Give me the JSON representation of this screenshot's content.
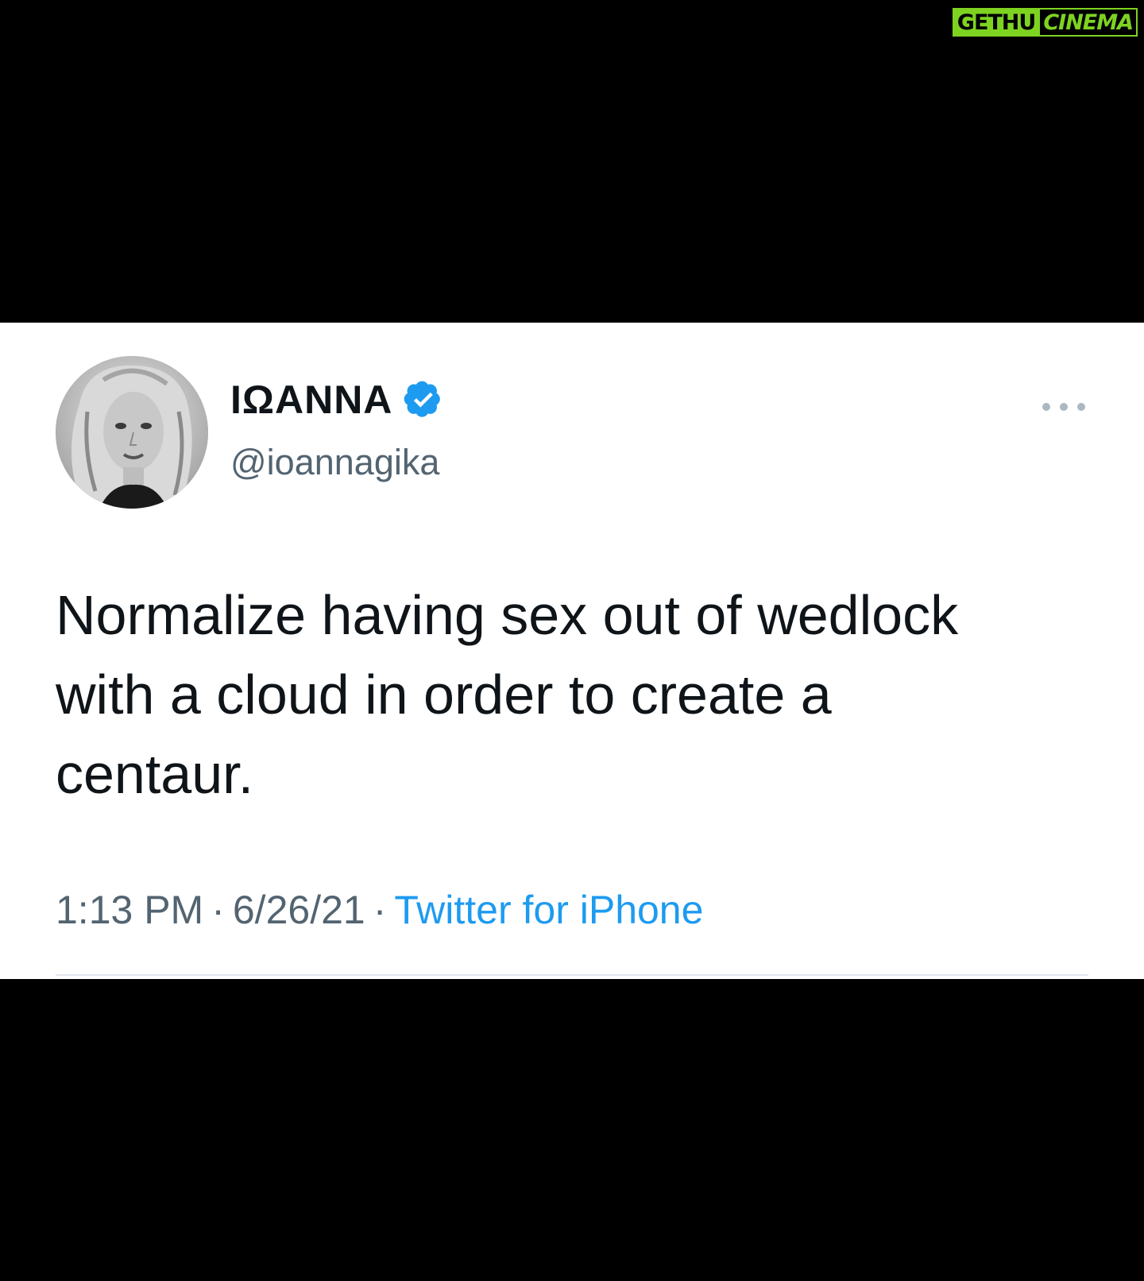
{
  "watermark": {
    "part1": "GETHU",
    "part2": "CINEMA",
    "accent_color": "#7ed321"
  },
  "tweet": {
    "display_name": "ΙΩΑΝΝΑ",
    "handle": "@ioannagika",
    "verified": true,
    "verified_icon": "verified-badge-icon",
    "verified_color": "#1d9bf0",
    "more_icon": "more-options-icon",
    "text": "Normalize having sex out of wedlock\nwith a cloud in order to create a\ncentaur.",
    "time": "1:13 PM",
    "separator": "·",
    "date": "6/26/21",
    "source": "Twitter for iPhone"
  }
}
